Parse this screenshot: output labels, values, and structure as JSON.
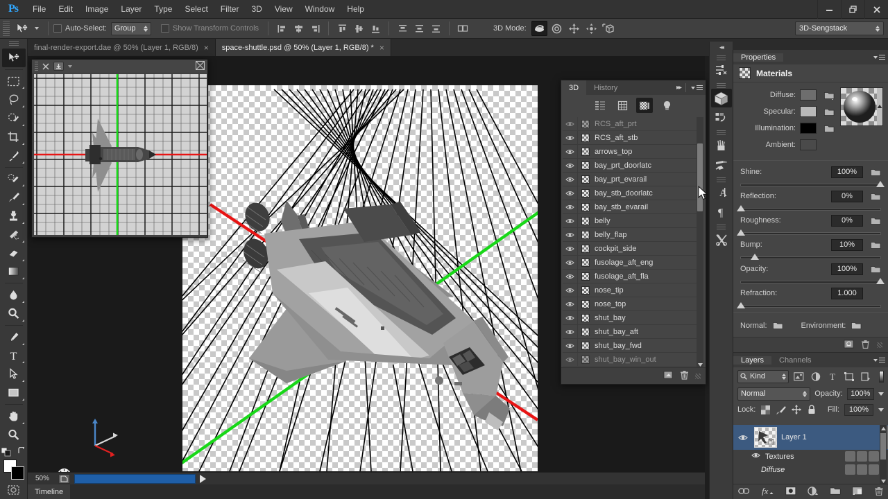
{
  "app": {
    "logo": "Ps",
    "menu": [
      "File",
      "Edit",
      "Image",
      "Layer",
      "Type",
      "Select",
      "Filter",
      "3D",
      "View",
      "Window",
      "Help"
    ],
    "window_controls": {
      "minimize": "–",
      "restore": "❐",
      "close": "✕"
    }
  },
  "options_bar": {
    "tool_icon": "move-tool-icon",
    "auto_select_label": "Auto-Select:",
    "auto_select_checked": false,
    "group_value": "Group",
    "show_transform_label": "Show Transform Controls",
    "show_transform_checked": false,
    "mode3d_label": "3D Mode:",
    "mode3d_icons": [
      "rotate-3d-icon",
      "roll-3d-icon",
      "pan-3d-icon",
      "slide-3d-icon",
      "scale-3d-icon"
    ],
    "mode3d_active_index": 0,
    "workspace": "3D-Sengstack"
  },
  "tabs": [
    {
      "label": "final-render-export.dae @ 50% (Layer 1, RGB/8)",
      "active": false,
      "close": "×"
    },
    {
      "label": "space-shuttle.psd @ 50% (Layer 1, RGB/8) *",
      "active": true,
      "close": "×"
    }
  ],
  "toolbar": {
    "tools": [
      "move-tool-icon",
      "rectangular-marquee-icon",
      "lasso-icon",
      "quick-selection-icon",
      "crop-icon",
      "eyedropper-icon",
      "healing-brush-icon",
      "brush-icon",
      "clone-stamp-icon",
      "history-brush-icon",
      "eraser-icon",
      "gradient-icon",
      "blur-icon",
      "dodge-icon",
      "pen-icon",
      "type-icon",
      "path-selection-icon",
      "rectangle-shape-icon",
      "hand-icon",
      "zoom-icon"
    ],
    "quickmask_icon": "quick-mask-icon",
    "swap_icon": "swap-colors-icon",
    "foreground_color": "#ffffff",
    "background_color": "#000000"
  },
  "floating_window": {
    "title_icons": [
      "grip-icon",
      "close-icon",
      "collapse-icon",
      "chevron-down-icon",
      "fit-screen-icon"
    ],
    "content": "top-down-orthographic-shuttle-view"
  },
  "canvas": {
    "grid_color": "#000000",
    "x_axis_color": "#e81414",
    "z_axis_color": "#18d818",
    "axis_widget": {
      "y_axis_color": "#4a86c8",
      "x_axis_color": "#d8d8d8",
      "z_axis_color": "#e02020"
    },
    "light_gizmo": "light-gizmo-icon"
  },
  "status_bar": {
    "zoom": "50%",
    "doc_icon": "document-icon",
    "progress_color": "#1f5fa8",
    "play_icon": "play-icon"
  },
  "timeline": {
    "tab_label": "Timeline"
  },
  "panel_3d": {
    "tabs": [
      {
        "label": "3D",
        "active": true
      },
      {
        "label": "History",
        "active": false
      }
    ],
    "collapse_icon": "double-arrow-right-icon",
    "menu_icon": "panel-menu-icon",
    "filters": [
      {
        "name": "scene-filter-icon",
        "active": false
      },
      {
        "name": "mesh-filter-icon",
        "active": false
      },
      {
        "name": "materials-filter-icon",
        "active": true
      },
      {
        "name": "lights-filter-icon",
        "active": false
      }
    ],
    "items": [
      {
        "name": "RCS_aft_prt",
        "partial": true
      },
      {
        "name": "RCS_aft_stb",
        "partial": false
      },
      {
        "name": "arrows_top",
        "partial": false
      },
      {
        "name": "bay_prt_doorlatc",
        "partial": false
      },
      {
        "name": "bay_prt_evarail",
        "partial": false
      },
      {
        "name": "bay_stb_doorlatc",
        "partial": false
      },
      {
        "name": "bay_stb_evarail",
        "partial": false
      },
      {
        "name": "belly",
        "partial": false
      },
      {
        "name": "belly_flap",
        "partial": false
      },
      {
        "name": "cockpit_side",
        "partial": false
      },
      {
        "name": "fusolage_aft_eng",
        "partial": false
      },
      {
        "name": "fusolage_aft_fla",
        "partial": false
      },
      {
        "name": "nose_tip",
        "partial": false
      },
      {
        "name": "nose_top",
        "partial": false
      },
      {
        "name": "shut_bay",
        "partial": false
      },
      {
        "name": "shut_bay_aft",
        "partial": false
      },
      {
        "name": "shut_bay_fwd",
        "partial": false
      },
      {
        "name": "shut_bay_win_out",
        "partial": true
      }
    ],
    "footer_icons": [
      "new-material-icon",
      "delete-icon"
    ]
  },
  "dock_strip": {
    "collapse_icon": "double-arrow-left-icon",
    "icons": [
      {
        "name": "adjustments-icon",
        "active": false
      },
      {
        "name": "3d-cube-icon",
        "active": true
      },
      {
        "name": "actions-icon",
        "active": false
      },
      {
        "name": "brush-presets-icon",
        "active": false
      },
      {
        "name": "brush-settings-icon",
        "active": false
      },
      {
        "name": "character-icon",
        "active": false
      },
      {
        "name": "paragraph-icon",
        "active": false
      },
      {
        "name": "tool-presets-icon",
        "active": false
      }
    ]
  },
  "properties": {
    "tab_label": "Properties",
    "menu_icon": "panel-menu-icon",
    "section_title": "Materials",
    "section_icon": "materials-icon",
    "colors": [
      {
        "label": "Diffuse:",
        "value": "#6e6e6e",
        "has_folder": true
      },
      {
        "label": "Specular:",
        "value": "#b9b9b9",
        "has_folder": true
      },
      {
        "label": "Illumination:",
        "value": "#000000",
        "has_folder": true
      },
      {
        "label": "Ambient:",
        "value": "#4a4a4a",
        "has_folder": false
      }
    ],
    "preview": "material-sphere-preview",
    "sliders": [
      {
        "label": "Shine:",
        "value": "100%",
        "pct": 100,
        "has_folder": true
      },
      {
        "label": "Reflection:",
        "value": "0%",
        "pct": 0,
        "has_folder": true
      },
      {
        "label": "Roughness:",
        "value": "0%",
        "pct": 0,
        "has_folder": true
      },
      {
        "label": "Bump:",
        "value": "10%",
        "pct": 10,
        "has_folder": true
      },
      {
        "label": "Opacity:",
        "value": "100%",
        "pct": 100,
        "has_folder": true
      },
      {
        "label": "Refraction:",
        "value": "1.000",
        "pct": 0,
        "has_folder": false
      }
    ],
    "normal_label": "Normal:",
    "environment_label": "Environment:",
    "footer_icons": [
      "new-material-icon",
      "delete-icon"
    ]
  },
  "layers": {
    "tabs": [
      {
        "label": "Layers",
        "active": true
      },
      {
        "label": "Channels",
        "active": false
      }
    ],
    "menu_icon": "panel-menu-icon",
    "filter_kind": "Kind",
    "search_icon": "search-icon",
    "filter_icons": [
      "pixel-filter-icon",
      "adjustment-filter-icon",
      "type-filter-icon",
      "shape-filter-icon",
      "smartobject-filter-icon"
    ],
    "blend_mode": "Normal",
    "opacity_label": "Opacity:",
    "opacity_value": "100%",
    "lock_label": "Lock:",
    "lock_icons": [
      "lock-transparent-icon",
      "lock-image-icon",
      "lock-position-icon",
      "lock-all-icon"
    ],
    "fill_label": "Fill:",
    "fill_value": "100%",
    "rows": [
      {
        "name": "Layer 1",
        "selected": true,
        "visible": true,
        "type": "layer"
      },
      {
        "name": "Textures",
        "selected": false,
        "visible": true,
        "type": "group"
      },
      {
        "name": "Diffuse",
        "selected": false,
        "visible": false,
        "type": "texture"
      }
    ],
    "footer_icons": [
      "link-icon",
      "fx-icon",
      "mask-icon",
      "adjustment-icon",
      "group-icon",
      "new-layer-icon",
      "delete-icon"
    ]
  }
}
